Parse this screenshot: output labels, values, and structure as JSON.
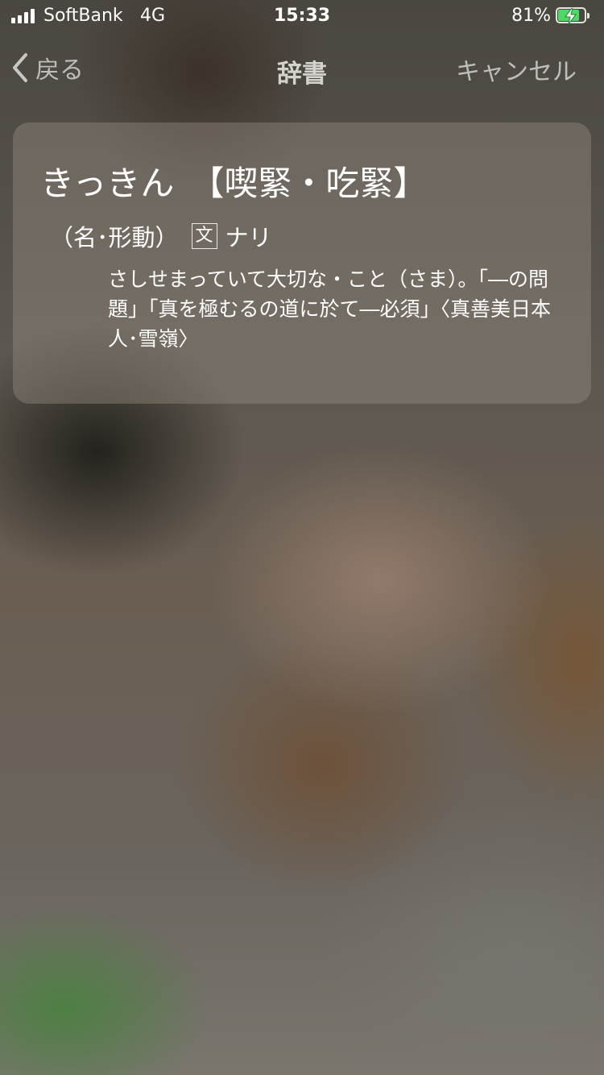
{
  "status_bar": {
    "carrier": "SoftBank",
    "network": "4G",
    "time": "15:33",
    "battery_percent": "81%",
    "battery_level": 0.81,
    "charging_icon": "bolt-icon",
    "battery_fill_color": "#4cd964"
  },
  "nav": {
    "back_label": "戻る",
    "title": "辞書",
    "cancel_label": "キャンセル"
  },
  "entry": {
    "reading": "きっきん",
    "kanji": "【喫緊・吃緊】",
    "part_of_speech": "（名･形動）",
    "classical_marker": "文",
    "classical_form": "ナリ",
    "definition": "さしせまっていて大切な・こと（さま）。「―の問題」「真を極むるの道に於て―必須」〈真善美日本人･雪嶺〉"
  }
}
